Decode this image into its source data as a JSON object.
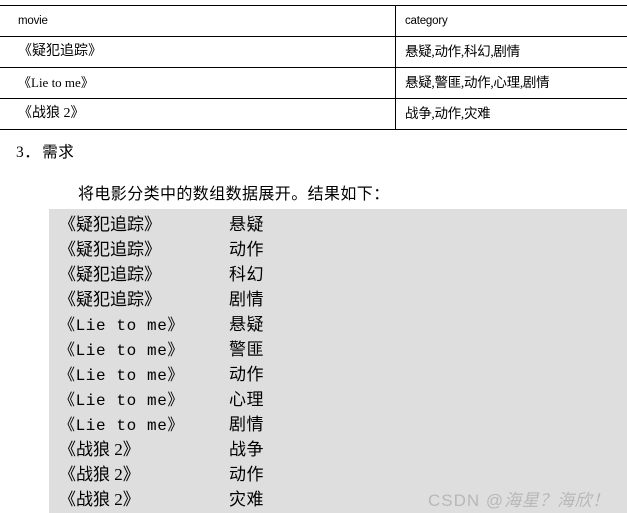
{
  "table": {
    "headers": {
      "movie": "movie",
      "category": "category"
    },
    "rows": [
      {
        "movie": "《疑犯追踪》",
        "category": "悬疑,动作,科幻,剧情"
      },
      {
        "movie": "《Lie to me》",
        "category": "悬疑,警匪,动作,心理,剧情"
      },
      {
        "movie": "《战狼 2》",
        "category": "战争,动作,灾难"
      }
    ]
  },
  "heading": {
    "number": "3．",
    "text": "需求"
  },
  "paragraph": {
    "text": "将电影分类中的数组数据展开。结果如下："
  },
  "result_block": {
    "background_color": "#dedede",
    "rows": [
      {
        "movie": "《疑犯追踪》",
        "category": "悬疑",
        "mono": false
      },
      {
        "movie": "《疑犯追踪》",
        "category": "动作",
        "mono": false
      },
      {
        "movie": "《疑犯追踪》",
        "category": "科幻",
        "mono": false
      },
      {
        "movie": "《疑犯追踪》",
        "category": "剧情",
        "mono": false
      },
      {
        "movie": "《Lie to me》",
        "category": "悬疑",
        "mono": true
      },
      {
        "movie": "《Lie to me》",
        "category": "警匪",
        "mono": true
      },
      {
        "movie": "《Lie to me》",
        "category": "动作",
        "mono": true
      },
      {
        "movie": "《Lie to me》",
        "category": "心理",
        "mono": true
      },
      {
        "movie": "《Lie to me》",
        "category": "剧情",
        "mono": true
      },
      {
        "movie": "《战狼 2》",
        "category": "战争",
        "mono": false
      },
      {
        "movie": "《战狼 2》",
        "category": "动作",
        "mono": false
      },
      {
        "movie": "《战狼 2》",
        "category": "灾难",
        "mono": false
      }
    ]
  },
  "watermark": {
    "prefix": "CSDN @",
    "text": "海星？海欣！",
    "color": "#b8b8b8"
  }
}
